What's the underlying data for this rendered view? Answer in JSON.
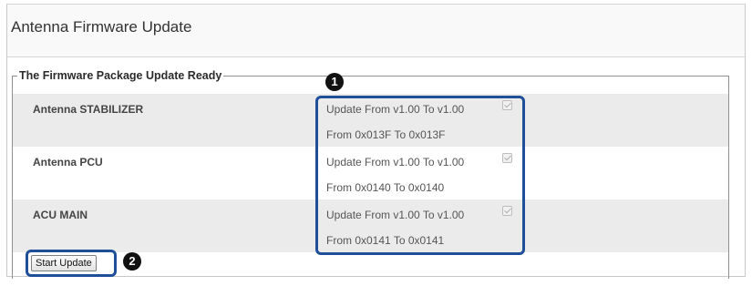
{
  "panel": {
    "title": "Antenna Firmware Update"
  },
  "package": {
    "legend": "The Firmware Package Update Ready",
    "items": [
      {
        "name": "Antenna STABILIZER",
        "update": "Update From v1.00 To v1.00",
        "range": "From 0x013F To 0x013F",
        "checked": true
      },
      {
        "name": "Antenna PCU",
        "update": "Update From v1.00 To v1.00",
        "range": "From 0x0140 To 0x0140",
        "checked": true
      },
      {
        "name": "ACU MAIN",
        "update": "Update From v1.00 To v1.00",
        "range": "From 0x0141 To 0x0141",
        "checked": true
      }
    ]
  },
  "actions": {
    "start_label": "Start Update"
  },
  "callouts": {
    "one": "1",
    "two": "2"
  },
  "colors": {
    "highlight": "#1f4f99",
    "row_shade": "#ebebeb"
  }
}
